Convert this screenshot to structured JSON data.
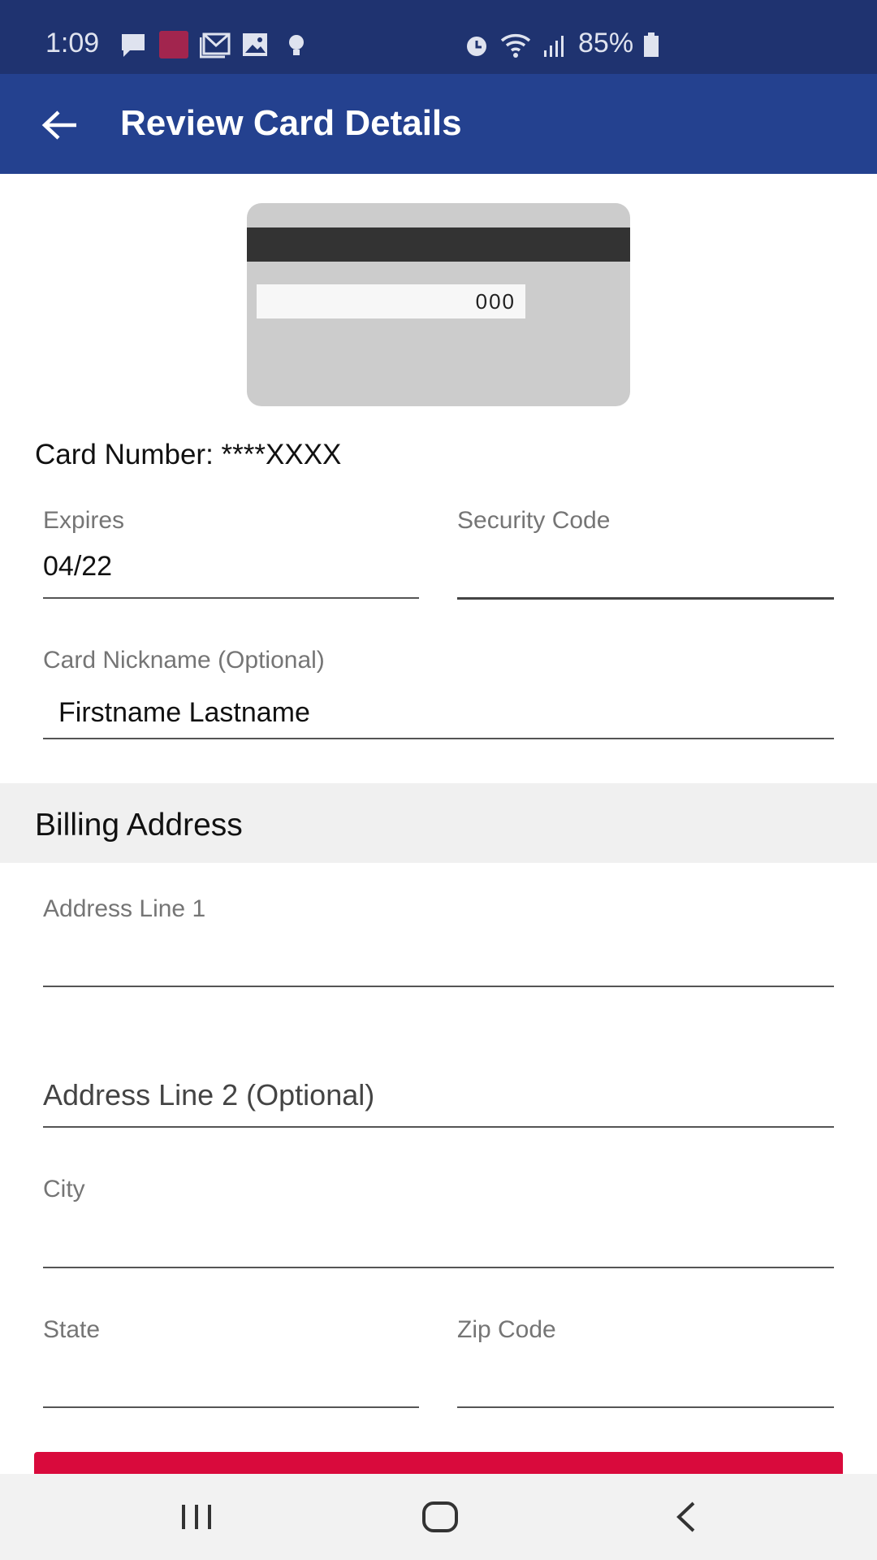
{
  "status_bar": {
    "time": "1:09",
    "battery": "85%",
    "icons": [
      "message-icon",
      "app-notification-icon",
      "gmail-icon",
      "gallery-icon",
      "bulb-icon",
      "alarm-icon",
      "wifi-icon",
      "signal-icon",
      "battery-icon"
    ]
  },
  "app_bar": {
    "title": "Review Card Details",
    "back_icon": "arrow-left-icon"
  },
  "card_image": {
    "cvv": "000"
  },
  "card_number": "Card Number: ****XXXX",
  "form": {
    "expires": {
      "label": "Expires",
      "value": "04/22"
    },
    "security_code": {
      "label": "Security Code",
      "value": ""
    },
    "nickname": {
      "label": "Card Nickname (Optional)",
      "value": "Firstname Lastname"
    }
  },
  "billing": {
    "title": "Billing Address",
    "address1": {
      "label": "Address Line 1",
      "value": ""
    },
    "address2": {
      "placeholder": "Address Line 2 (Optional)"
    },
    "city": {
      "label": "City",
      "value": ""
    },
    "state": {
      "label": "State",
      "value": ""
    },
    "zip": {
      "label": "Zip Code",
      "value": ""
    }
  },
  "colors": {
    "status_bar": "#1f3370",
    "app_bar": "#24418f",
    "button": "#d90a3c"
  }
}
